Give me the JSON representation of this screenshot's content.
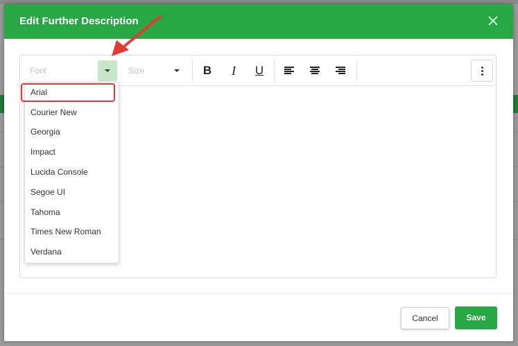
{
  "dialog": {
    "title": "Edit Further Description",
    "close_icon": "close-icon"
  },
  "toolbar": {
    "font_placeholder": "Font",
    "size_placeholder": "Size",
    "bold_label": "B",
    "italic_label": "I",
    "underline_label": "U",
    "align_left_icon": "align-left-icon",
    "align_center_icon": "align-center-icon",
    "align_right_icon": "align-right-icon",
    "more_icon": "more-vertical-icon"
  },
  "font_dropdown": {
    "selected_index": 0,
    "options": [
      "Arial",
      "Courier New",
      "Georgia",
      "Impact",
      "Lucida Console",
      "Segoe UI",
      "Tahoma",
      "Times New Roman",
      "Verdana"
    ]
  },
  "footer": {
    "cancel_label": "Cancel",
    "save_label": "Save"
  },
  "colors": {
    "accent": "#28a745",
    "annotation": "#e53935"
  }
}
